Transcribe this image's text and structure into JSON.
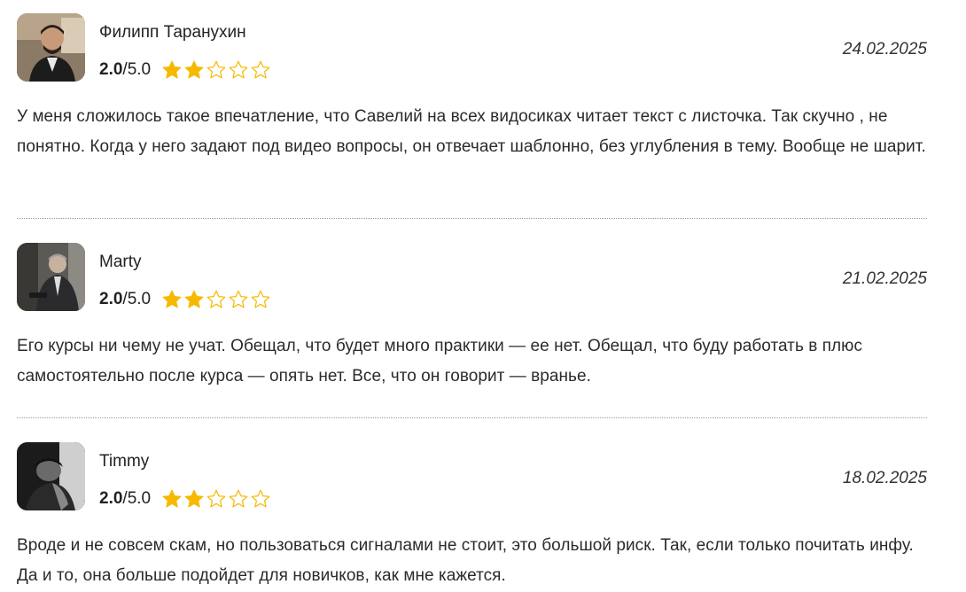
{
  "reviews": [
    {
      "author": "Филипп Таранухин",
      "score": "2.0",
      "max": "/5.0",
      "stars": 2,
      "date": "24.02.2025",
      "text": "У меня сложилось такое впечатление, что Савелий на всех видосиках читает текст с листочка. Так скучно , не понятно. Когда у него задают под видео вопросы, он отвечает шаблонно, без углубления в тему. Вообще не шарит."
    },
    {
      "author": "Marty",
      "score": "2.0",
      "max": "/5.0",
      "stars": 2,
      "date": "21.02.2025",
      "text": "Его курсы ни чему не учат. Обещал, что будет много практики — ее нет. Обещал, что буду работать в плюс самостоятельно после курса — опять нет. Все, что он говорит — вранье."
    },
    {
      "author": "Timmy",
      "score": "2.0",
      "max": "/5.0",
      "stars": 2,
      "date": "18.02.2025",
      "text": "Вроде и не совсем скам, но пользоваться сигналами не стоит, это большой риск. Так, если только почитать инфу. Да и то, она больше подойдет для новичков, как мне кажется."
    }
  ],
  "colors": {
    "star_filled": "#f6b900",
    "star_empty_outline": "#f6b900",
    "divider": "#9a9a9a"
  }
}
